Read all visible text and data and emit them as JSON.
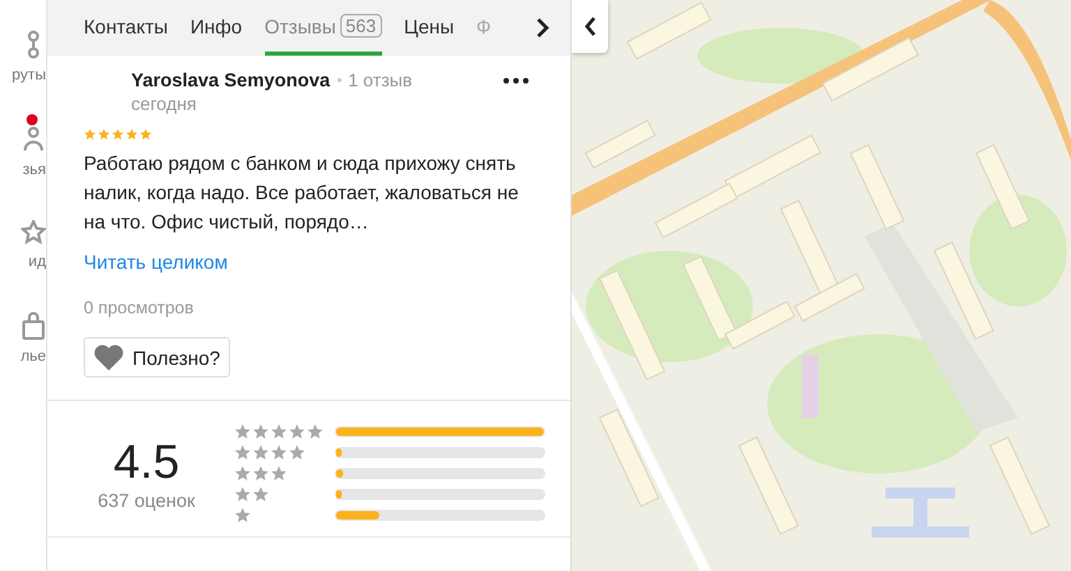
{
  "nav": [
    {
      "label": "руты",
      "badge": false
    },
    {
      "label": "зья",
      "badge": true
    },
    {
      "label": "ид",
      "badge": false
    },
    {
      "label": "лье",
      "badge": false
    }
  ],
  "tabs": [
    {
      "label": "Контакты",
      "selected": false
    },
    {
      "label": "Инфо",
      "selected": false
    },
    {
      "label": "Отзывы",
      "count": "563",
      "selected": true
    },
    {
      "label": "Цены",
      "selected": false
    },
    {
      "label": "Ф",
      "selected": false,
      "faded": true
    }
  ],
  "review": {
    "author": "Yaroslava Semyonova",
    "author_reviews": "1 отзыв",
    "date": "сегодня",
    "stars": 5,
    "text": "Работаю рядом с банком и сюда прихожу снять налик, когда надо. Все работает, жаловаться не на что. Офис чистый, порядо…",
    "read_more": "Читать целиком",
    "views": "0 просмотров",
    "helpful": "Полезно?"
  },
  "summary": {
    "score": "4.5",
    "count": "637 оценок",
    "distribution": [
      {
        "level": 1.0
      },
      {
        "level": 0.025
      },
      {
        "level": 0.035
      },
      {
        "level": 0.03
      },
      {
        "level": 0.21
      }
    ]
  }
}
